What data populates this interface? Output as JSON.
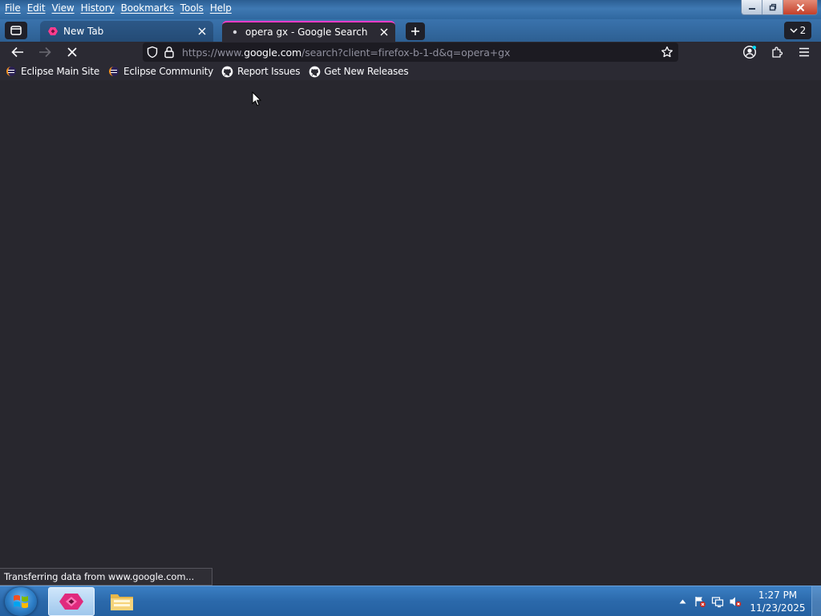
{
  "menubar": {
    "items": [
      "File",
      "Edit",
      "View",
      "History",
      "Bookmarks",
      "Tools",
      "Help"
    ]
  },
  "tabs": [
    {
      "title": "New Tab",
      "active": false
    },
    {
      "title": "opera gx - Google Search",
      "active": true
    }
  ],
  "tab_list": {
    "count": "2"
  },
  "navbar": {
    "url_prefix": "https://www.",
    "url_host": "google.com",
    "url_path": "/search?client=firefox-b-1-d&q=opera+gx"
  },
  "bookmarks": [
    {
      "label": "Eclipse Main Site",
      "icon": "eclipse-icon"
    },
    {
      "label": "Eclipse Community",
      "icon": "eclipse-icon"
    },
    {
      "label": "Report Issues",
      "icon": "github-icon"
    },
    {
      "label": "Get New Releases",
      "icon": "github-icon"
    }
  ],
  "status": {
    "text": "Transferring data from www.google.com..."
  },
  "taskbar": {
    "clock_time": "1:27 PM",
    "clock_date": "11/23/2025"
  },
  "colors": {
    "accent_tab": "#ff3cc8",
    "browser_bg": "#28272e",
    "toolbar_bg": "#2b2a33",
    "taskbar": "#2b69ab"
  }
}
